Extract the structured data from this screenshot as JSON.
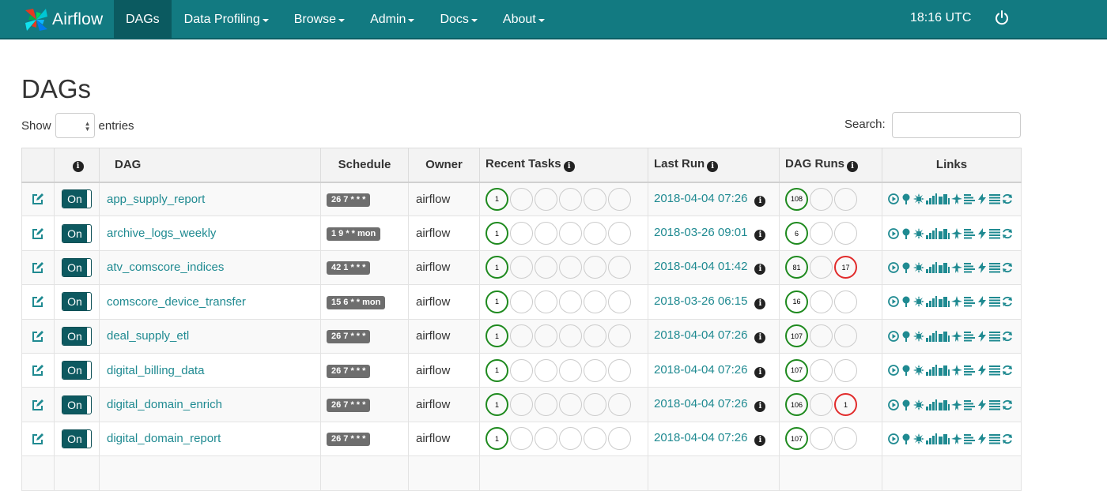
{
  "navbar": {
    "brand": "Airflow",
    "items": [
      {
        "label": "DAGs",
        "active": true,
        "dropdown": false
      },
      {
        "label": "Data Profiling",
        "active": false,
        "dropdown": true
      },
      {
        "label": "Browse",
        "active": false,
        "dropdown": true
      },
      {
        "label": "Admin",
        "active": false,
        "dropdown": true
      },
      {
        "label": "Docs",
        "active": false,
        "dropdown": true
      },
      {
        "label": "About",
        "active": false,
        "dropdown": true
      }
    ],
    "time": "18:16 UTC"
  },
  "page": {
    "title": "DAGs",
    "show_label": "Show",
    "entries_label": "entries",
    "entries_value": "",
    "search_label": "Search:",
    "search_value": ""
  },
  "table": {
    "headers": {
      "dag": "DAG",
      "schedule": "Schedule",
      "owner": "Owner",
      "recent_tasks": "Recent Tasks",
      "last_run": "Last Run",
      "dag_runs": "DAG Runs",
      "links": "Links"
    },
    "rows": [
      {
        "toggle": "On",
        "dag": "app_supply_report",
        "schedule": "26 7 * * *",
        "owner": "airflow",
        "recent_tasks": [
          "1",
          "",
          "",
          "",
          "",
          ""
        ],
        "last_run": "2018-04-04 07:26",
        "dag_runs": [
          {
            "v": "108",
            "s": "success"
          },
          {
            "v": "",
            "s": ""
          },
          {
            "v": "",
            "s": ""
          }
        ]
      },
      {
        "toggle": "On",
        "dag": "archive_logs_weekly",
        "schedule": "1 9 * * mon",
        "owner": "airflow",
        "recent_tasks": [
          "1",
          "",
          "",
          "",
          "",
          ""
        ],
        "last_run": "2018-03-26 09:01",
        "dag_runs": [
          {
            "v": "6",
            "s": "success"
          },
          {
            "v": "",
            "s": ""
          },
          {
            "v": "",
            "s": ""
          }
        ]
      },
      {
        "toggle": "On",
        "dag": "atv_comscore_indices",
        "schedule": "42 1 * * *",
        "owner": "airflow",
        "recent_tasks": [
          "1",
          "",
          "",
          "",
          "",
          ""
        ],
        "last_run": "2018-04-04 01:42",
        "dag_runs": [
          {
            "v": "81",
            "s": "success"
          },
          {
            "v": "",
            "s": ""
          },
          {
            "v": "17",
            "s": "failed"
          }
        ]
      },
      {
        "toggle": "On",
        "dag": "comscore_device_transfer",
        "schedule": "15 6 * * mon",
        "owner": "airflow",
        "recent_tasks": [
          "1",
          "",
          "",
          "",
          "",
          ""
        ],
        "last_run": "2018-03-26 06:15",
        "dag_runs": [
          {
            "v": "16",
            "s": "success"
          },
          {
            "v": "",
            "s": ""
          },
          {
            "v": "",
            "s": ""
          }
        ]
      },
      {
        "toggle": "On",
        "dag": "deal_supply_etl",
        "schedule": "26 7 * * *",
        "owner": "airflow",
        "recent_tasks": [
          "1",
          "",
          "",
          "",
          "",
          ""
        ],
        "last_run": "2018-04-04 07:26",
        "dag_runs": [
          {
            "v": "107",
            "s": "success"
          },
          {
            "v": "",
            "s": ""
          },
          {
            "v": "",
            "s": ""
          }
        ]
      },
      {
        "toggle": "On",
        "dag": "digital_billing_data",
        "schedule": "26 7 * * *",
        "owner": "airflow",
        "recent_tasks": [
          "1",
          "",
          "",
          "",
          "",
          ""
        ],
        "last_run": "2018-04-04 07:26",
        "dag_runs": [
          {
            "v": "107",
            "s": "success"
          },
          {
            "v": "",
            "s": ""
          },
          {
            "v": "",
            "s": ""
          }
        ]
      },
      {
        "toggle": "On",
        "dag": "digital_domain_enrich",
        "schedule": "26 7 * * *",
        "owner": "airflow",
        "recent_tasks": [
          "1",
          "",
          "",
          "",
          "",
          ""
        ],
        "last_run": "2018-04-04 07:26",
        "dag_runs": [
          {
            "v": "106",
            "s": "success"
          },
          {
            "v": "",
            "s": ""
          },
          {
            "v": "1",
            "s": "failed"
          }
        ]
      },
      {
        "toggle": "On",
        "dag": "digital_domain_report",
        "schedule": "26 7 * * *",
        "owner": "airflow",
        "recent_tasks": [
          "1",
          "",
          "",
          "",
          "",
          ""
        ],
        "last_run": "2018-04-04 07:26",
        "dag_runs": [
          {
            "v": "107",
            "s": "success"
          },
          {
            "v": "",
            "s": ""
          },
          {
            "v": "",
            "s": ""
          }
        ]
      },
      {
        "toggle": "",
        "dag": "",
        "schedule": "",
        "owner": "",
        "recent_tasks": [],
        "last_run": "",
        "dag_runs": []
      }
    ]
  },
  "link_icons": [
    "trigger-dag-icon",
    "tree-view-icon",
    "graph-view-icon",
    "duration-chart-icon",
    "task-tries-icon",
    "landing-times-icon",
    "gantt-icon",
    "code-view-icon",
    "logs-icon",
    "refresh-icon"
  ],
  "colors": {
    "navbar": "#127a81",
    "active_nav": "#0b5a60",
    "link": "#1f8a91",
    "success": "#1f8a1f",
    "failed": "#e12b2b"
  }
}
